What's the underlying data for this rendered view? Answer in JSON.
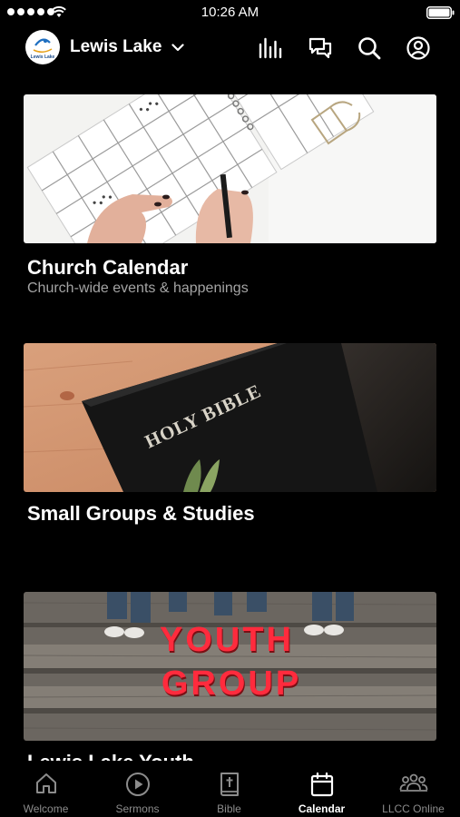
{
  "status_bar": {
    "time": "10:26 AM"
  },
  "header": {
    "logo_text": "Lewis Lake",
    "campus_name": "Lewis Lake",
    "icons": [
      "audio-bars-icon",
      "chat-icon",
      "search-icon",
      "profile-icon"
    ]
  },
  "cards": [
    {
      "title": "Church Calendar",
      "subtitle": "Church-wide events & happenings"
    },
    {
      "title": "Small Groups & Studies",
      "image_text": "HOLY BIBLE"
    },
    {
      "title": "Lewis Lake Youth",
      "image_text_line1": "YOUTH",
      "image_text_line2": "GROUP"
    }
  ],
  "tabs": [
    {
      "label": "Welcome",
      "icon": "home-icon",
      "active": false
    },
    {
      "label": "Sermons",
      "icon": "play-icon",
      "active": false
    },
    {
      "label": "Bible",
      "icon": "bible-icon",
      "active": false
    },
    {
      "label": "Calendar",
      "icon": "calendar-icon",
      "active": true
    },
    {
      "label": "LLCC Online",
      "icon": "people-icon",
      "active": false
    }
  ],
  "colors": {
    "background": "#000000",
    "text": "#ffffff",
    "muted": "#a4a4a4",
    "tab_inactive": "#8c8c8c",
    "youth_red": "#ff2b3d"
  }
}
